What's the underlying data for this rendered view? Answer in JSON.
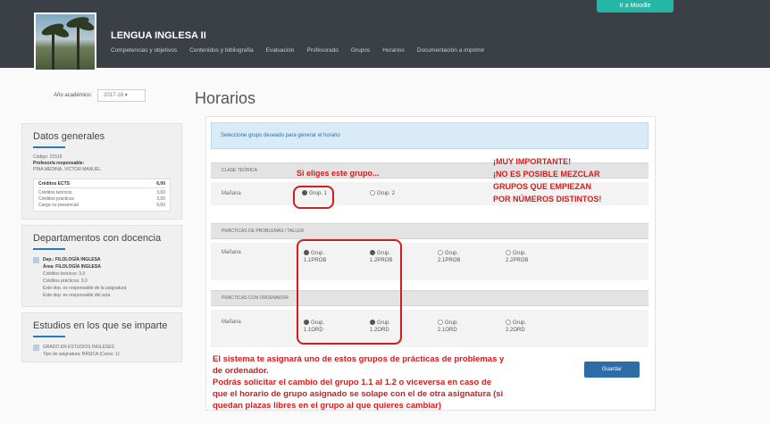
{
  "header": {
    "accent_button": "Ir a Moodle",
    "course_title": "LENGUA INGLESA II",
    "nav": [
      "Competencias y objetivos",
      "Contenidos y bibliografía",
      "Evaluación",
      "Profesorado",
      "Grupos",
      "Horarios",
      "Documentación a imprimir"
    ]
  },
  "sidebar": {
    "year_label": "Año académico:",
    "year_value": "2017-18",
    "general": {
      "title": "Datos generales",
      "code": "Código: 21515",
      "responsible_label": "Profesor/a responsable:",
      "responsible_name": "PINA MEDINA, VICTOR MANUEL",
      "credits_label": "Créditos ECTS",
      "credits_value": "6,00",
      "rows": [
        {
          "label": "Créditos teóricos",
          "value": "3,00"
        },
        {
          "label": "Créditos prácticos",
          "value": "3,00"
        },
        {
          "label": "Carga no presencial",
          "value": "9,00"
        }
      ]
    },
    "departments": {
      "title": "Departamentos con docencia",
      "items": [
        {
          "label": "Dep.: FILOLOGÍA INGLESA"
        },
        {
          "label": "Área: FILOLOGÍA INGLESA"
        },
        {
          "label": "Créditos teóricos: 3,0"
        },
        {
          "label": "Créditos prácticos: 3,0"
        },
        {
          "label": "Este dep. es responsable de la asignatura"
        },
        {
          "label": "Este dep. es responsable del acta"
        }
      ]
    },
    "studies": {
      "title": "Estudios en los que se imparte",
      "items": [
        "GRADO EN ESTUDIOS INGLESES",
        "Tipo de asignatura: BÁSICA (Curso: 1)"
      ]
    }
  },
  "main": {
    "title": "Horarios",
    "info": "Seleccione grupo deseado para generar el horario",
    "theory": {
      "header": "CLASE TEÓRICA",
      "mode": "Mañana",
      "options": [
        {
          "label": "Grup. 1",
          "checked": true
        },
        {
          "label": "Grup. 2",
          "checked": false
        }
      ]
    },
    "problems": {
      "header": "PRÁCTICAS DE PROBLEMAS / TALLER",
      "mode": "Mañana",
      "options": [
        {
          "label": "Grup.",
          "sub": "1.1PROB",
          "checked": true
        },
        {
          "label": "Grup.",
          "sub": "1.2PROB",
          "checked": true
        },
        {
          "label": "Grup.",
          "sub": "2.1PROB",
          "checked": false
        },
        {
          "label": "Grup.",
          "sub": "2.2PROB",
          "checked": false
        }
      ]
    },
    "computer": {
      "header": "PRÁCTICAS CON ORDENADOR",
      "mode": "Mañana",
      "options": [
        {
          "label": "Grup.",
          "sub": "1.1ORD",
          "checked": true
        },
        {
          "label": "Grup.",
          "sub": "1.2ORD",
          "checked": true
        },
        {
          "label": "Grup.",
          "sub": "2.1ORD",
          "checked": false
        },
        {
          "label": "Grup.",
          "sub": "2.2ORD",
          "checked": false
        }
      ]
    },
    "save_button": "Guardar",
    "annotations": {
      "pick": "Si eliges este grupo...",
      "important": [
        "¡MUY IMPORTANTE!",
        "¡NO ES POSIBLE MEZCLAR",
        "GRUPOS QUE EMPIEZAN",
        "POR NÚMEROS DISTINTOS!"
      ],
      "bottom": [
        "El sistema te asignará uno de estos grupos de prácticas de problemas y",
        "de ordenador.",
        "Podrás solicitar el cambio del grupo 1.1 al 1.2 o viceversa en caso de",
        "que el horario de grupo asignado se solape con el de otra asignatura (si",
        "quedan plazas libres en el grupo al que quieres cambiar)"
      ]
    }
  }
}
